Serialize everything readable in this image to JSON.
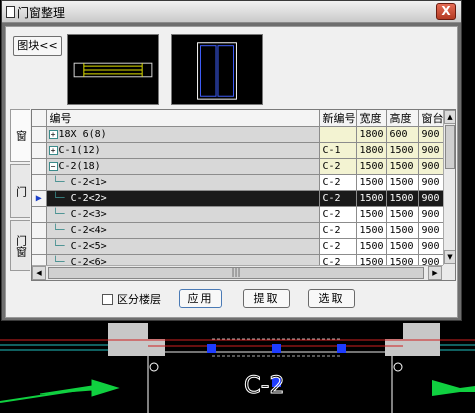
{
  "window": {
    "title": "门窗整理",
    "close_label": "X"
  },
  "toolbar": {
    "block_button": "图块<<"
  },
  "tabs": [
    "窗",
    "门",
    "门窗"
  ],
  "grid": {
    "columns": [
      "编号",
      "新编号",
      "宽度",
      "高度",
      "窗台"
    ],
    "rows": [
      {
        "indicator": "",
        "name": "18X 6(8)",
        "expander": "+",
        "level": 0,
        "new_no": "",
        "width": "1800",
        "height": "600",
        "sill": "900",
        "selected": false
      },
      {
        "indicator": "",
        "name": "C-1(12)",
        "expander": "+",
        "level": 0,
        "new_no": "C-1",
        "width": "1800",
        "height": "1500",
        "sill": "900",
        "selected": false
      },
      {
        "indicator": "",
        "name": "C-2(18)",
        "expander": "−",
        "level": 0,
        "new_no": "C-2",
        "width": "1500",
        "height": "1500",
        "sill": "900",
        "selected": false
      },
      {
        "indicator": "",
        "name": "C-2<1>",
        "expander": "",
        "level": 1,
        "new_no": "C-2",
        "width": "1500",
        "height": "1500",
        "sill": "900",
        "selected": false
      },
      {
        "indicator": "▶",
        "name": "C-2<2>",
        "expander": "",
        "level": 1,
        "new_no": "C-2",
        "width": "1500",
        "height": "1500",
        "sill": "900",
        "selected": true
      },
      {
        "indicator": "",
        "name": "C-2<3>",
        "expander": "",
        "level": 1,
        "new_no": "C-2",
        "width": "1500",
        "height": "1500",
        "sill": "900",
        "selected": false
      },
      {
        "indicator": "",
        "name": "C-2<4>",
        "expander": "",
        "level": 1,
        "new_no": "C-2",
        "width": "1500",
        "height": "1500",
        "sill": "900",
        "selected": false
      },
      {
        "indicator": "",
        "name": "C-2<5>",
        "expander": "",
        "level": 1,
        "new_no": "C-2",
        "width": "1500",
        "height": "1500",
        "sill": "900",
        "selected": false
      },
      {
        "indicator": "",
        "name": "C-2<6>",
        "expander": "",
        "level": 1,
        "new_no": "C-2",
        "width": "1500",
        "height": "1500",
        "sill": "900",
        "selected": false
      }
    ]
  },
  "footer": {
    "floor_checkbox_label": "区分楼层",
    "floor_checked": false,
    "apply_label": "应用",
    "pick_label": "提取",
    "select_label": "选取"
  },
  "cad": {
    "window_label": "C-2",
    "colors": {
      "wall": "#c8c8c8",
      "grip": "#1e3cff",
      "arrow": "#10d040",
      "line_red": "#d02020",
      "line_cyan": "#20c0c0"
    }
  }
}
